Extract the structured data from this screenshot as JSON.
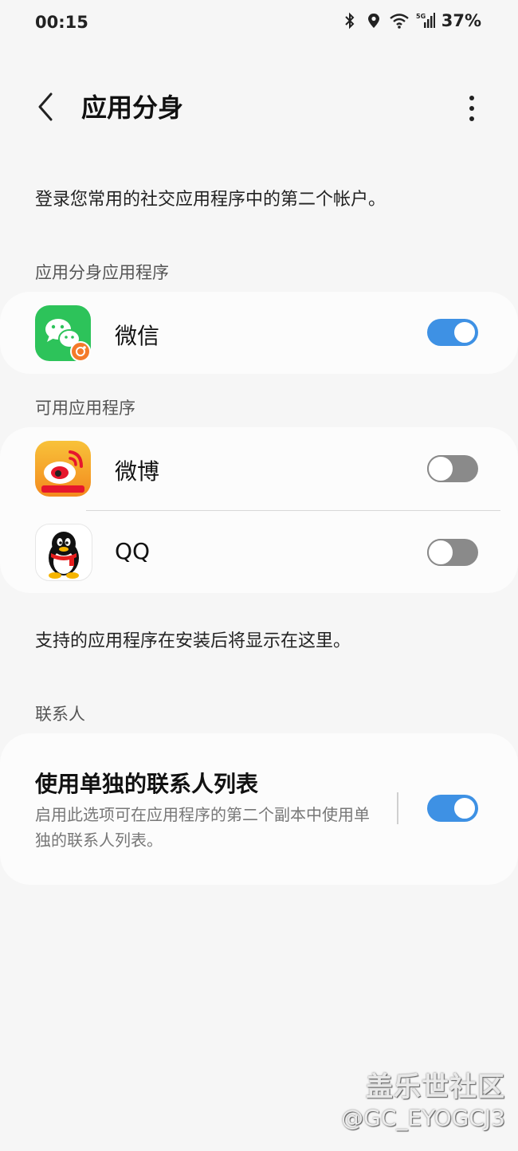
{
  "status_bar": {
    "time": "00:15",
    "battery": "37%",
    "signal_label": "5G",
    "icons": [
      "bluetooth-icon",
      "location-icon",
      "wifi-icon",
      "signal-icon"
    ]
  },
  "app_bar": {
    "title": "应用分身",
    "back_icon": "chevron-left-icon",
    "more_icon": "more-vertical-icon"
  },
  "intro": "登录您常用的社交应用程序中的第二个帐户。",
  "cloned_section": {
    "label": "应用分身应用程序",
    "items": [
      {
        "name": "微信",
        "enabled": true,
        "icon": "wechat-icon"
      }
    ]
  },
  "available_section": {
    "label": "可用应用程序",
    "items": [
      {
        "name": "微博",
        "enabled": false,
        "icon": "weibo-icon"
      },
      {
        "name": "QQ",
        "enabled": false,
        "icon": "qq-icon"
      }
    ]
  },
  "footer_note": "支持的应用程序在安装后将显示在这里。",
  "contacts_section": {
    "label": "联系人",
    "title": "使用单独的联系人列表",
    "description": "启用此选项可在应用程序的第二个副本中使用单独的联系人列表。",
    "enabled": true
  },
  "watermark": {
    "line1": "盖乐世社区",
    "line2": "@GC_EYOGCJ3"
  },
  "colors": {
    "accent": "#3e91e4",
    "toggle_off": "#8a8a8a",
    "background": "#f6f6f6",
    "card": "#fcfcfc",
    "wechat_green": "#2dc35a",
    "clone_badge": "#f47a2a",
    "weibo_orange": "#f6a21e"
  }
}
